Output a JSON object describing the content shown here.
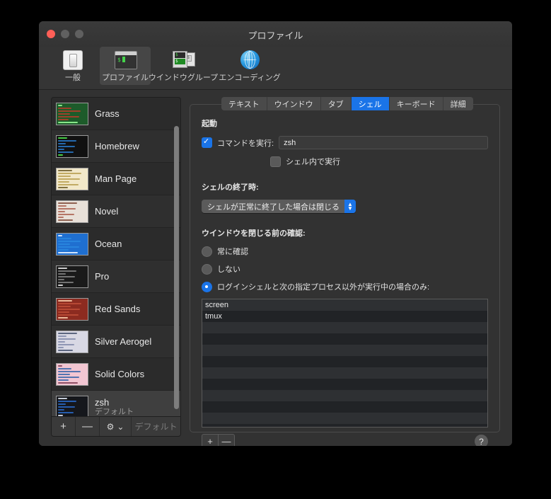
{
  "window": {
    "title": "プロファイル",
    "traffic_lights": [
      "close-button",
      "minimize-button",
      "maximize-button"
    ]
  },
  "toolbar": {
    "items": [
      {
        "label": "一般",
        "icon": "toggle-switch-icon",
        "selected": false
      },
      {
        "label": "プロファイル",
        "icon": "terminal-icon",
        "selected": true
      },
      {
        "label": "ウインドウグループ",
        "icon": "window-group-icon",
        "selected": false
      },
      {
        "label": "エンコーディング",
        "icon": "globe-icon",
        "selected": false
      }
    ]
  },
  "sidebar": {
    "profiles": [
      {
        "name": "Grass",
        "subtitle": "",
        "selected": false
      },
      {
        "name": "Homebrew",
        "subtitle": "",
        "selected": false
      },
      {
        "name": "Man Page",
        "subtitle": "",
        "selected": false
      },
      {
        "name": "Novel",
        "subtitle": "",
        "selected": false
      },
      {
        "name": "Ocean",
        "subtitle": "",
        "selected": false
      },
      {
        "name": "Pro",
        "subtitle": "",
        "selected": false
      },
      {
        "name": "Red Sands",
        "subtitle": "",
        "selected": false
      },
      {
        "name": "Silver Aerogel",
        "subtitle": "",
        "selected": false
      },
      {
        "name": "Solid Colors",
        "subtitle": "",
        "selected": false
      },
      {
        "name": "zsh",
        "subtitle": "デフォルト",
        "selected": true
      }
    ],
    "footer": {
      "add_label": "+",
      "remove_label": "—",
      "gear_label": "⚙",
      "gear_chevron": "⌄",
      "default_label": "デフォルト"
    }
  },
  "tabs": [
    {
      "label": "テキスト",
      "active": false
    },
    {
      "label": "ウインドウ",
      "active": false
    },
    {
      "label": "タブ",
      "active": false
    },
    {
      "label": "シェル",
      "active": true
    },
    {
      "label": "キーボード",
      "active": false
    },
    {
      "label": "詳細",
      "active": false
    }
  ],
  "shell_panel": {
    "startup_title": "起動",
    "run_command_label": "コマンドを実行:",
    "run_command_checked": true,
    "command_value": "zsh",
    "run_inside_shell_label": "シェル内で実行",
    "run_inside_shell_checked": false,
    "on_exit_title": "シェルの終了時:",
    "on_exit_value": "シェルが正常に終了した場合は閉じる",
    "close_confirm_title": "ウインドウを閉じる前の確認:",
    "radios": [
      {
        "label": "常に確認",
        "selected": false
      },
      {
        "label": "しない",
        "selected": false
      },
      {
        "label": "ログインシェルと次の指定プロセス以外が実行中の場合のみ:",
        "selected": true
      }
    ],
    "process_list": [
      "screen",
      "tmux"
    ],
    "list_add_label": "+",
    "list_remove_label": "—",
    "help_label": "?"
  },
  "colors": {
    "accent": "#1a74e8",
    "window_bg": "#323232",
    "close_red": "#ff5f57"
  }
}
